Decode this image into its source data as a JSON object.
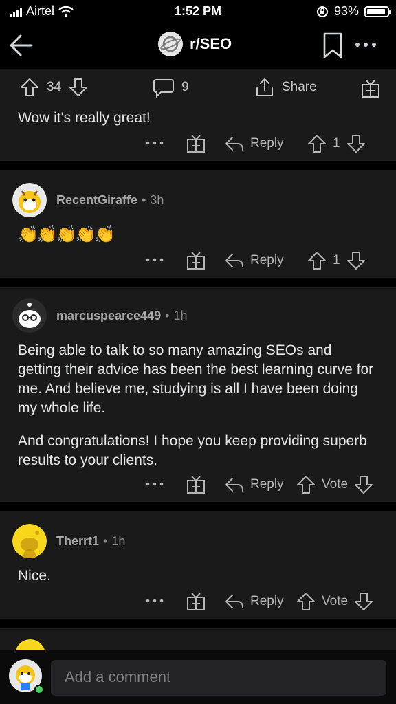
{
  "status_bar": {
    "carrier": "Airtel",
    "time": "1:52 PM",
    "battery": "93%",
    "battery_level": 0.93
  },
  "header": {
    "subreddit": "r/SEO"
  },
  "post_actions": {
    "upvotes": "34",
    "comments": "9",
    "share": "Share"
  },
  "comments": [
    {
      "text": "Wow it's really great!",
      "reply": "Reply",
      "vote": "1"
    },
    {
      "username": "RecentGiraffe",
      "age": "3h",
      "text": "👏👏👏👏👏",
      "reply": "Reply",
      "vote": "1"
    },
    {
      "username": "marcuspearce449",
      "age": "1h",
      "paragraphs": [
        "Being able to talk to so many amazing SEOs and getting their advice has been the best learning curve for me. And believe me, studying is all I have been doing my whole life.",
        "And congratulations! I hope you keep providing superb results to your clients."
      ],
      "reply": "Reply",
      "vote": "Vote"
    },
    {
      "username": "Therrt1",
      "age": "1h",
      "text": "Nice.",
      "reply": "Reply",
      "vote": "Vote"
    }
  ],
  "composer": {
    "placeholder": "Add a comment"
  },
  "colors": {
    "background": "#000000",
    "card": "#1a1a1b",
    "text": "#d7dadc",
    "muted": "#8e9091",
    "input": "#232325",
    "online": "#46d160"
  }
}
